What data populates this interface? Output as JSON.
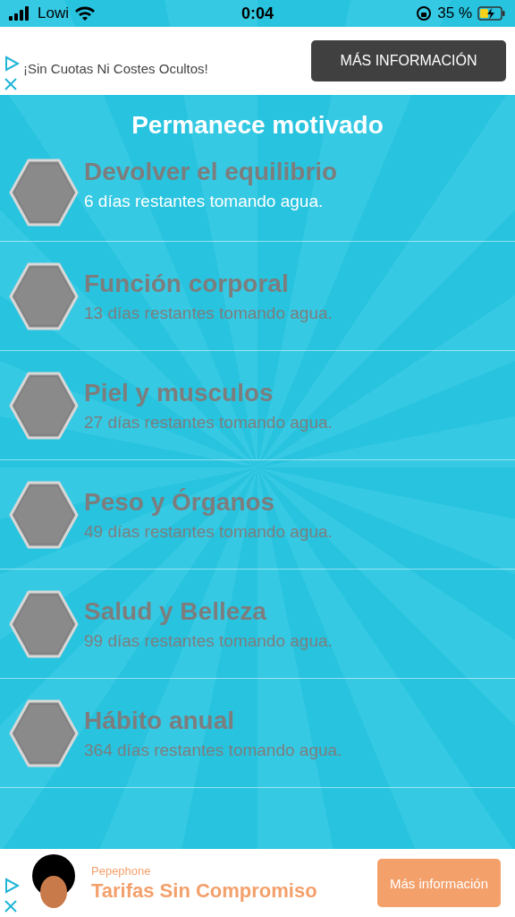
{
  "status_bar": {
    "carrier": "Lowi",
    "time": "0:04",
    "battery": "35 %"
  },
  "top_ad": {
    "text": "¡Sin Cuotas Ni Costes Ocultos!",
    "button": "MÁS INFORMACIÓN"
  },
  "title": "Permanece motivado",
  "goals": [
    {
      "name": "Devolver el equilibrio",
      "subtitle": "6 días restantes tomando agua.",
      "current": true
    },
    {
      "name": "Función corporal",
      "subtitle": "13 días restantes tomando agua.",
      "current": false
    },
    {
      "name": "Piel y musculos",
      "subtitle": "27 días restantes tomando agua.",
      "current": false
    },
    {
      "name": "Peso y Órganos",
      "subtitle": "49 días restantes tomando agua.",
      "current": false
    },
    {
      "name": "Salud y Belleza",
      "subtitle": "99 días restantes tomando agua.",
      "current": false
    },
    {
      "name": "Hábito anual",
      "subtitle": "364 días restantes tomando agua.",
      "current": false
    }
  ],
  "bottom_ad": {
    "brand": "Pepephone",
    "headline": "Tarifas Sin Compromiso",
    "button": "Más información"
  }
}
